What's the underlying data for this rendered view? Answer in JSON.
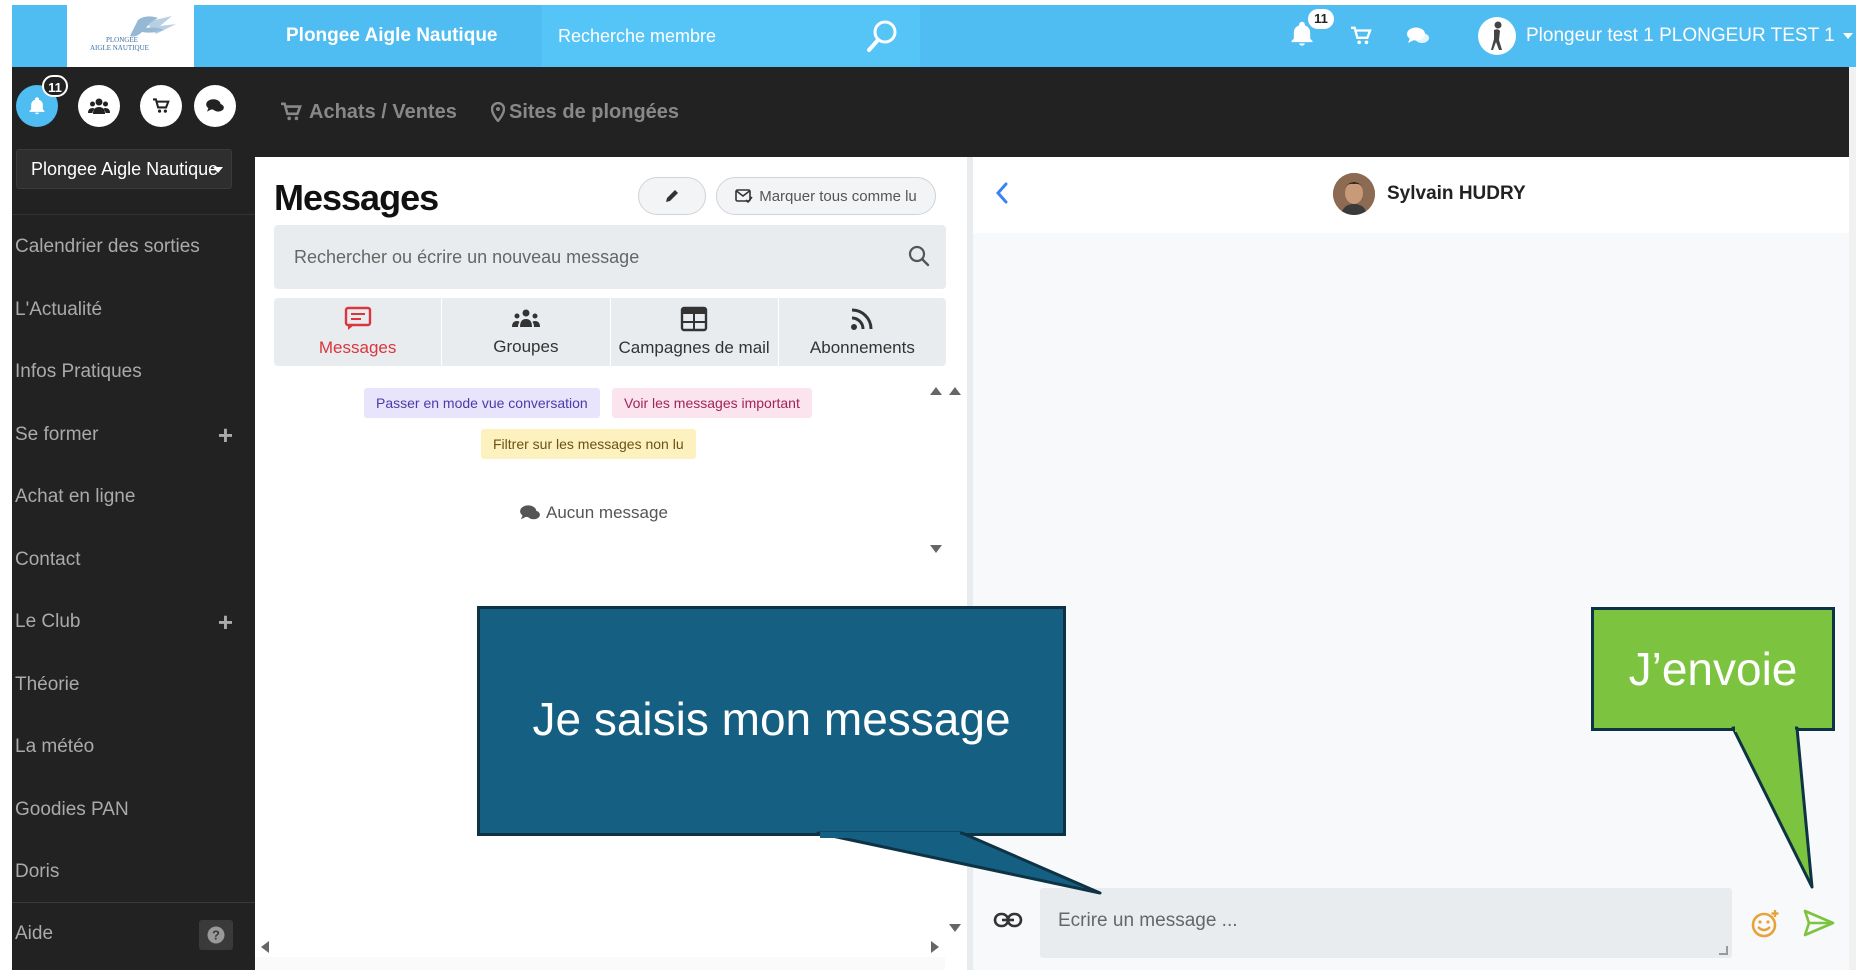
{
  "header": {
    "logo_text_line1": "PLONGEE",
    "logo_text_line2": "AIGLE NAUTIQUE",
    "brand": "Plongee Aigle Nautique",
    "search_placeholder": "Recherche membre",
    "notif_count": "11",
    "user_name": "Plongeur test 1 PLONGEUR TEST 1"
  },
  "sidebar": {
    "notif_count": "11",
    "club_selector": "Plongee Aigle Nautique",
    "items": [
      {
        "label": "Calendrier des sorties"
      },
      {
        "label": "L'Actualité"
      },
      {
        "label": "Infos Pratiques"
      },
      {
        "label": "Se former",
        "expand": "+"
      },
      {
        "label": "Achat en ligne"
      },
      {
        "label": "Contact"
      },
      {
        "label": "Le Club",
        "expand": "+"
      },
      {
        "label": "Théorie"
      },
      {
        "label": "La météo"
      },
      {
        "label": "Goodies PAN"
      },
      {
        "label": "Doris"
      }
    ],
    "help_label": "Aide"
  },
  "nav": {
    "purchases": "Achats / Ventes",
    "dive_sites": "Sites de plongées"
  },
  "messages": {
    "title": "Messages",
    "mark_all_read": "Marquer tous comme lu",
    "search_placeholder": "Rechercher ou écrire un nouveau message",
    "tabs": [
      {
        "label": "Messages",
        "icon": "message-icon",
        "active": true
      },
      {
        "label": "Groupes",
        "icon": "groups-icon",
        "active": false
      },
      {
        "label": "Campagnes de mail",
        "icon": "calendar-table-icon",
        "active": false
      },
      {
        "label": "Abonnements",
        "icon": "rss-icon",
        "active": false
      }
    ],
    "filter_conversation": "Passer en mode vue conversation",
    "filter_important": "Voir les messages important",
    "filter_unread": "Filtrer sur les messages non lu",
    "empty": "Aucun message"
  },
  "conversation": {
    "contact_name": "Sylvain HUDRY",
    "compose_placeholder": "Ecrire un message ..."
  },
  "callouts": {
    "compose_hint": "Je saisis mon message",
    "send_hint": "J’envoie"
  },
  "colors": {
    "topbar": "#4fbcf2",
    "sidebar": "#222222",
    "active_tab": "#d9363e",
    "callout_blue": "#145f82",
    "callout_green": "#7cc33f",
    "send": "#7cc33f",
    "emoji": "#e8a23a"
  }
}
